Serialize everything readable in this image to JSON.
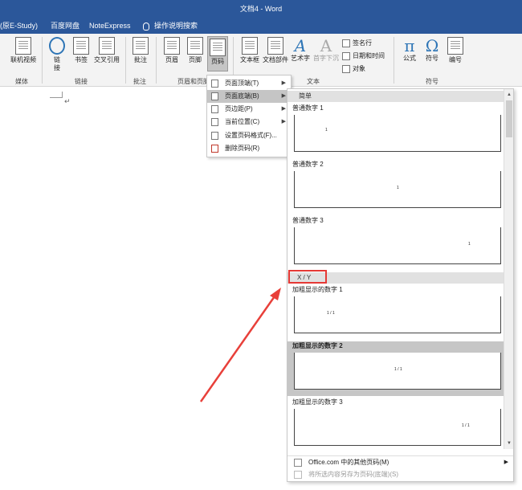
{
  "titlebar": {
    "title": "文档4  -  Word"
  },
  "tabs": [
    {
      "label": "(原E-Study)"
    },
    {
      "label": "百度网盘"
    },
    {
      "label": "NoteExpress"
    },
    {
      "label": "操作说明搜索"
    }
  ],
  "ribbon": {
    "buttons": {
      "online_video": "联机视频",
      "link": "链\n接",
      "bookmark": "书签",
      "cross_ref": "交叉引用",
      "comment": "批注",
      "header": "页眉",
      "footer": "页脚",
      "page_number": "页码",
      "textbox": "文本框",
      "quick_parts": "文档部件",
      "wordart": "艺术字",
      "dropcap": "首字下沉",
      "signature_line": "签名行",
      "datetime": "日期和时间",
      "object": "对象",
      "equation": "公式",
      "symbol": "符号",
      "number": "编号",
      "equation_glyph": "π",
      "symbol_glyph": "Ω"
    },
    "groups": {
      "media": "媒体",
      "links": "链接",
      "comments": "批注",
      "header_footer": "页眉和页脚",
      "text": "文本",
      "symbols": "符号"
    }
  },
  "document": {
    "para_mark": "↵"
  },
  "page_number_menu": {
    "items": [
      {
        "label": "页面顶端(T)",
        "has_submenu": true,
        "icon": "page-top-icon"
      },
      {
        "label": "页面底端(B)",
        "has_submenu": true,
        "icon": "page-bottom-icon"
      },
      {
        "label": "页边距(P)",
        "has_submenu": true,
        "icon": "page-margin-icon"
      },
      {
        "label": "当前位置(C)",
        "has_submenu": true,
        "icon": "current-position-icon"
      },
      {
        "label": "设置页码格式(F)...",
        "has_submenu": false,
        "icon": "format-page-number-icon"
      },
      {
        "label": "删除页码(R)",
        "has_submenu": false,
        "icon": "remove-page-number-icon"
      }
    ]
  },
  "gallery": {
    "section_simple": "简单",
    "section_xy": "X / Y",
    "items": [
      {
        "label": "普通数字 1",
        "num": "1"
      },
      {
        "label": "普通数字 2",
        "num": "1"
      },
      {
        "label": "普通数字 3",
        "num": "1"
      },
      {
        "label": "加粗显示的数字 1",
        "num": "1 / 1"
      },
      {
        "label": "加粗显示的数字 2",
        "num": "1 / 1"
      },
      {
        "label": "加粗显示的数字 3",
        "num": "1 / 1"
      }
    ],
    "footer_more": "Office.com 中的其他页码(M)",
    "footer_save": "将所选内容另存为页码(底端)(S)"
  },
  "colors": {
    "title_blue": "#2b579a",
    "highlight_red": "#e53935",
    "arrow_red": "#e8403a"
  }
}
